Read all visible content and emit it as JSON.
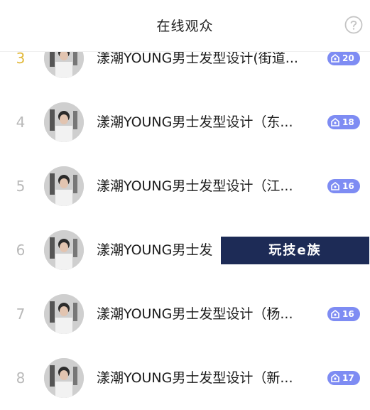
{
  "header": {
    "title": "在线观众",
    "help_icon": "question-circle-icon"
  },
  "viewers": [
    {
      "rank": "3",
      "name": "漾潮YOUNG男士发型设计(街道...",
      "level": "20",
      "top": true
    },
    {
      "rank": "4",
      "name": "漾潮YOUNG男士发型设计（东...",
      "level": "18",
      "top": false
    },
    {
      "rank": "5",
      "name": "漾潮YOUNG男士发型设计（江...",
      "level": "16",
      "top": false
    },
    {
      "rank": "6",
      "name": "漾潮YOUNG男士发",
      "level": "",
      "top": false
    },
    {
      "rank": "7",
      "name": "漾潮YOUNG男士发型设计（杨...",
      "level": "16",
      "top": false
    },
    {
      "rank": "8",
      "name": "漾潮YOUNG男士发型设计（新...",
      "level": "17",
      "top": false
    }
  ],
  "watermark": {
    "text": "玩技e族"
  },
  "colors": {
    "rank_gold": "#e2b93b",
    "badge": "#7e8cf3"
  }
}
